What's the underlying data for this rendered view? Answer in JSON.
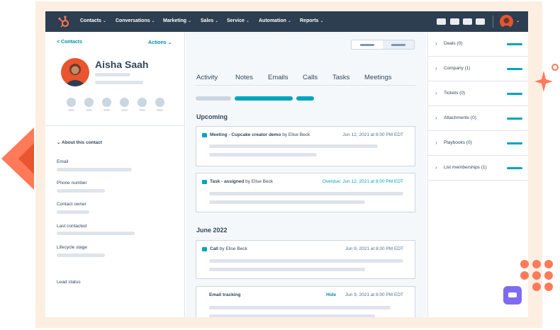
{
  "nav": {
    "items": [
      {
        "label": "Contacts",
        "chevron": "⌄"
      },
      {
        "label": "Conversations",
        "chevron": "⌄"
      },
      {
        "label": "Marketing",
        "chevron": "⌄"
      },
      {
        "label": "Sales",
        "chevron": "⌄"
      },
      {
        "label": "Service",
        "chevron": "⌄"
      },
      {
        "label": "Automation",
        "chevron": "⌄"
      },
      {
        "label": "Reports",
        "chevron": "⌄"
      }
    ],
    "icons": [
      "hubspot-logo-icon",
      "user-avatar-icon"
    ],
    "bg_color": "#2d3e50"
  },
  "contact": {
    "back_label": "< Contacts",
    "actions_label": "Actions ⌄",
    "name": "Aisha Saah",
    "about_label": "⌄ About this contact",
    "fields": [
      "Email",
      "Phone number",
      "Contact owner",
      "Last contacted",
      "Lifecycle stage",
      "Lead status"
    ]
  },
  "tabs": [
    "Activity",
    "Notes",
    "Emails",
    "Calls",
    "Tasks",
    "Meetings"
  ],
  "timeline": {
    "sections": [
      "Upcoming",
      "June 2022"
    ],
    "cards": [
      {
        "type": "Meeting - Cupcake creator demo",
        "by": "by Elise Beck",
        "date": "Jun 12, 2021 at 8:00 PM EDT",
        "overdue": false
      },
      {
        "type": "Task - assigned",
        "by": "by Elise Beck",
        "date": "Overdue: Jun 12, 2021 at 8:00 PM EDT",
        "overdue": true
      },
      {
        "type": "Call",
        "by": "by Elise Beck",
        "date": "Jun 9, 2021 at 8:00 PM EDT",
        "overdue": false
      },
      {
        "type": "Email tracking",
        "by": "",
        "hide": "Hide",
        "date": "Jun 9, 2021 at 8:00 PM EDT",
        "overdue": false
      }
    ]
  },
  "sidebar": {
    "items": [
      {
        "label": "Deals (0)"
      },
      {
        "label": "Company (1)"
      },
      {
        "label": "Tickets (0)"
      },
      {
        "label": "Attachments (0)"
      },
      {
        "label": "Playbooks (0)"
      },
      {
        "label": "List memberships (1)"
      }
    ],
    "chevron": "›"
  },
  "colors": {
    "accent": "#00a4bd",
    "link": "#0091ae",
    "brand_orange": "#ff7a59",
    "chat_purple": "#7e6cf0",
    "frame_peach": "#fdeee2"
  }
}
